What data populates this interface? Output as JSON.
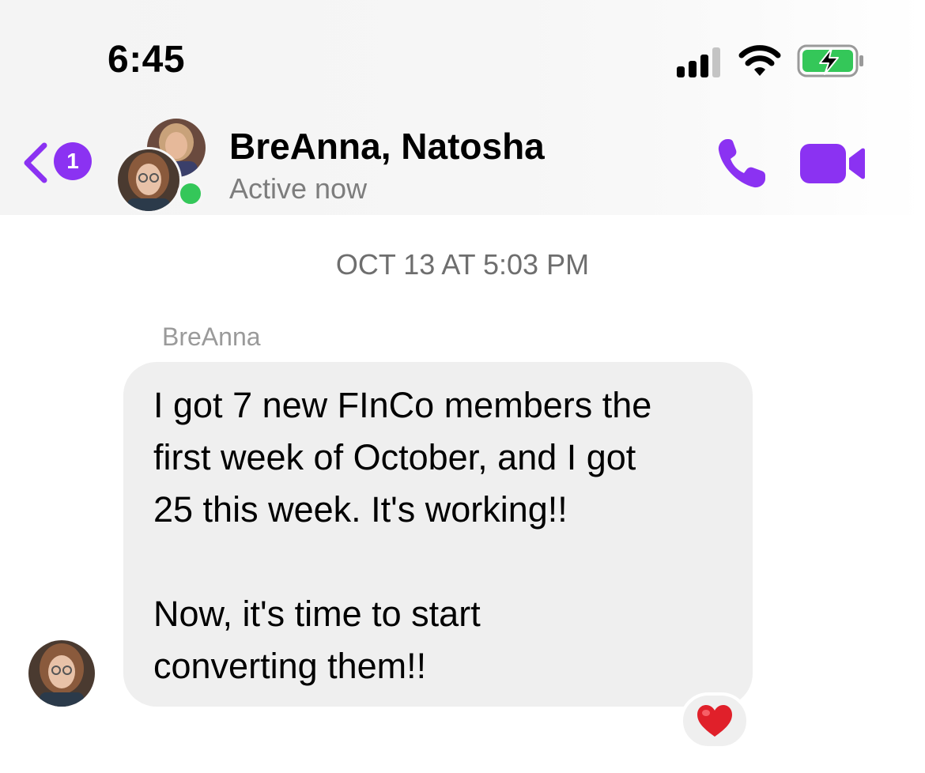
{
  "status_bar": {
    "time": "6:45",
    "icons": [
      "cellular-signal-icon",
      "wifi-icon",
      "battery-charging-icon"
    ]
  },
  "header": {
    "back_badge_count": "1",
    "title": "BreAnna, Natosha",
    "status": "Active now",
    "actions": [
      "phone-icon",
      "video-camera-icon"
    ]
  },
  "conversation": {
    "timestamp": "OCT 13 AT 5:03 PM",
    "messages": [
      {
        "sender": "BreAnna",
        "lines": [
          "I got 7 new FInCo members the",
          "first week of October, and I got",
          "25 this week. It's working!!",
          "Now, it's time to start",
          "converting them!!"
        ],
        "reaction": "heart"
      }
    ]
  },
  "colors": {
    "accent": "#8b32f2",
    "online": "#34c759",
    "bubble": "#efefef",
    "battery": "#34c759",
    "reaction": "#e0202a"
  }
}
